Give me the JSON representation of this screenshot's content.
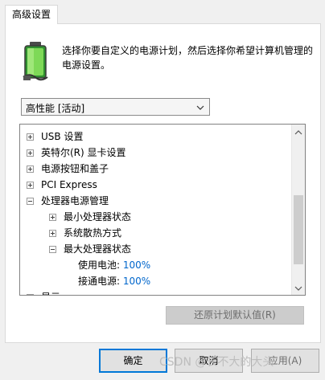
{
  "tab": {
    "label": "高级设置"
  },
  "description": "选择你要自定义的电源计划，然后选择你希望计算机管理的电源设置。",
  "plan_select": {
    "value": "高性能 [活动]"
  },
  "tree": {
    "items": [
      {
        "label": "USB 设置",
        "state": "collapsed"
      },
      {
        "label": "英特尔(R) 显卡设置",
        "state": "collapsed"
      },
      {
        "label": "电源按钮和盖子",
        "state": "collapsed"
      },
      {
        "label": "PCI Express",
        "state": "collapsed"
      },
      {
        "label": "处理器电源管理",
        "state": "expanded"
      },
      {
        "label": "最小处理器状态",
        "state": "collapsed"
      },
      {
        "label": "系统散热方式",
        "state": "collapsed"
      },
      {
        "label": "最大处理器状态",
        "state": "expanded"
      },
      {
        "label": "显示",
        "state": "collapsed"
      }
    ],
    "battery_label": "使用电池:",
    "battery_value": "100%",
    "plugged_label": "接通电源:",
    "plugged_value": "100%"
  },
  "buttons": {
    "restore": "还原计划默认值(R)",
    "ok": "确定",
    "cancel": "取消",
    "apply": "应用(A)"
  },
  "watermark": "CSDN @长不大的大头",
  "colors": {
    "accent": "#0078d7",
    "value_blue": "#0066cc"
  }
}
